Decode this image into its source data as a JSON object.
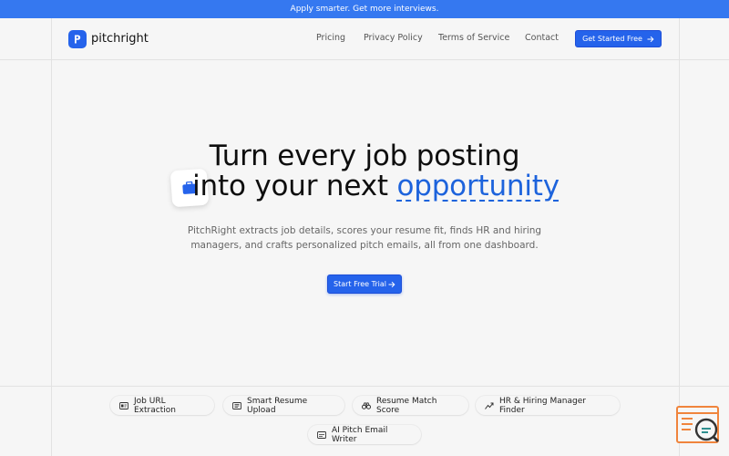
{
  "banner": {
    "text": "Apply smarter. Get more interviews."
  },
  "brand": {
    "name": "pitchright",
    "color": "#2563eb"
  },
  "nav": {
    "links": [
      "Pricing",
      "Privacy Policy",
      "Terms of Service",
      "Contact"
    ],
    "cta_label": "Get Started Free"
  },
  "hero": {
    "line1": "Turn every job posting",
    "line2_prefix": "into your next",
    "line2_accent": "opportunity",
    "subtitle": "PitchRight extracts job details, scores your resume fit, finds HR and hiring managers, and crafts personalized pitch emails, all from one dashboard.",
    "cta_label": "Start Free Trial"
  },
  "features": [
    {
      "label": "Job URL Extraction",
      "icon": "id-card-icon"
    },
    {
      "label": "Smart Resume Upload",
      "icon": "document-icon"
    },
    {
      "label": "Resume Match Score",
      "icon": "binoculars-icon"
    },
    {
      "label": "HR & Hiring Manager Finder",
      "icon": "trend-icon"
    },
    {
      "label": "AI Pitch Email Writer",
      "icon": "mail-icon"
    }
  ],
  "colors": {
    "accent": "#2563eb",
    "banner": "#3578f0",
    "widget": "#f0843c"
  }
}
